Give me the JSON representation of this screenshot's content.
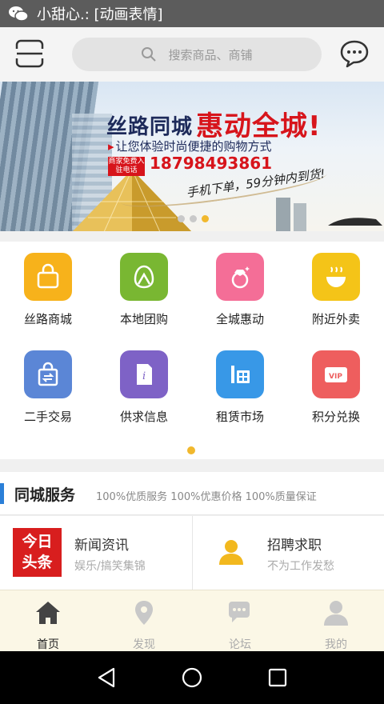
{
  "statusbar": {
    "title": "小甜心.: [动画表情]",
    "icon": "wechat-icon"
  },
  "header": {
    "search_placeholder": "搜索商品、商铺",
    "scan_icon": "scan-icon",
    "chat_icon": "chat-icon"
  },
  "banner": {
    "headline_left": "丝路同城",
    "headline_right": "惠动全城!",
    "subline": "让您体验时尚便捷的购物方式",
    "tag": "商家免费入驻电话",
    "phone": "18798493861",
    "slogan": "手机下单，59分钟内到货!",
    "dots_count": 3,
    "active_dot": 3
  },
  "grid": {
    "items": [
      {
        "label": "丝路商城",
        "icon": "shopping-bag-icon",
        "color": "#f7b21b"
      },
      {
        "label": "本地团购",
        "icon": "group-buy-bag-icon",
        "color": "#79b732"
      },
      {
        "label": "全城惠动",
        "icon": "diamond-ring-icon",
        "color": "#f46e97"
      },
      {
        "label": "附近外卖",
        "icon": "food-bowl-icon",
        "color": "#f4c418"
      },
      {
        "label": "二手交易",
        "icon": "exchange-bag-icon",
        "color": "#5b86d6"
      },
      {
        "label": "供求信息",
        "icon": "info-document-icon",
        "color": "#7e62c6"
      },
      {
        "label": "租赁市场",
        "icon": "building-icon",
        "color": "#3898e7"
      },
      {
        "label": "积分兑换",
        "icon": "vip-card-icon",
        "color": "#ee5e5e"
      }
    ],
    "page_count": 1,
    "active_page": 1
  },
  "section": {
    "title": "同城服务",
    "tagline": "100%优质服务 100%优惠价格 100%质量保证"
  },
  "services": [
    {
      "title": "新闻资讯",
      "subtitle": "娱乐/搞笑集锦",
      "logo_lines": [
        "今日",
        "头条"
      ]
    },
    {
      "title": "招聘求职",
      "subtitle": "不为工作发愁",
      "icon": "person-icon"
    }
  ],
  "tabs": [
    {
      "label": "首页",
      "icon": "home-icon",
      "active": true
    },
    {
      "label": "发现",
      "icon": "location-pin-icon",
      "active": false
    },
    {
      "label": "论坛",
      "icon": "forum-icon",
      "active": false
    },
    {
      "label": "我的",
      "icon": "user-icon",
      "active": false
    }
  ],
  "colors": {
    "accent": "#f1b82d",
    "brand_red": "#d7141b",
    "section_bar": "#2b7fd8",
    "tabbar_bg": "#fbf7e6"
  }
}
